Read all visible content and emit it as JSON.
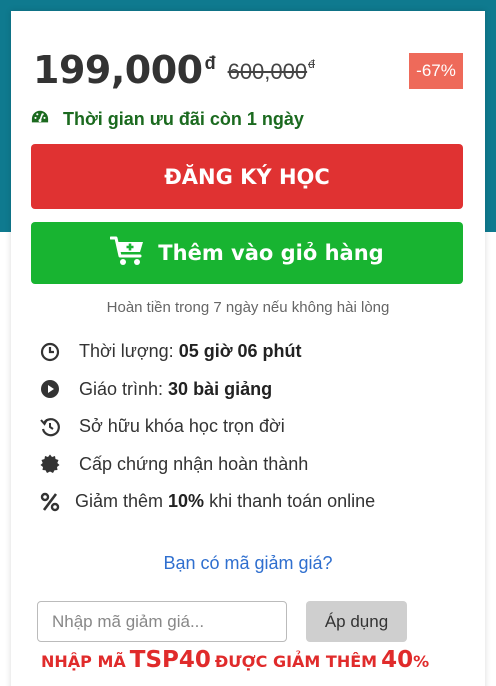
{
  "pricing": {
    "price": "199,000",
    "currency": "đ",
    "old_price": "600,000",
    "discount": "-67%"
  },
  "promo": {
    "text": "Thời gian ưu đãi còn 1 ngày",
    "icon": "tachometer-icon"
  },
  "buttons": {
    "register": "ĐĂNG KÝ HỌC",
    "add_to_cart": "Thêm vào giỏ hàng"
  },
  "refund_note": "Hoàn tiền trong 7 ngày nếu không hài lòng",
  "features": [
    {
      "icon": "clock-icon",
      "prefix": "Thời lượng: ",
      "bold": "05 giờ 06 phút",
      "suffix": ""
    },
    {
      "icon": "play-circle-icon",
      "prefix": "Giáo trình: ",
      "bold": "30 bài giảng",
      "suffix": ""
    },
    {
      "icon": "history-icon",
      "prefix": "Sở hữu khóa học trọn đời",
      "bold": "",
      "suffix": ""
    },
    {
      "icon": "certificate-icon",
      "prefix": "Cấp chứng nhận hoàn thành",
      "bold": "",
      "suffix": ""
    },
    {
      "icon": "percent-icon",
      "prefix": "Giảm thêm ",
      "bold": "10%",
      "suffix": " khi thanh toán online"
    }
  ],
  "coupon": {
    "link": "Bạn có mã giảm giá?",
    "placeholder": "Nhập mã giảm giá...",
    "apply": "Áp dụng",
    "code_text_1": "NHẬP MÃ",
    "code": "TSP40",
    "code_text_2": "ĐƯỢC GIẢM THÊM",
    "code_discount": "40",
    "code_percent": "%"
  },
  "colors": {
    "header_bg": "#0f7a8f",
    "register": "#e03232",
    "cart": "#18b431",
    "badge": "#ee6a5a",
    "promo_green": "#1b6a1f",
    "link": "#2f6fcf",
    "promo_red": "#e02b2b"
  }
}
